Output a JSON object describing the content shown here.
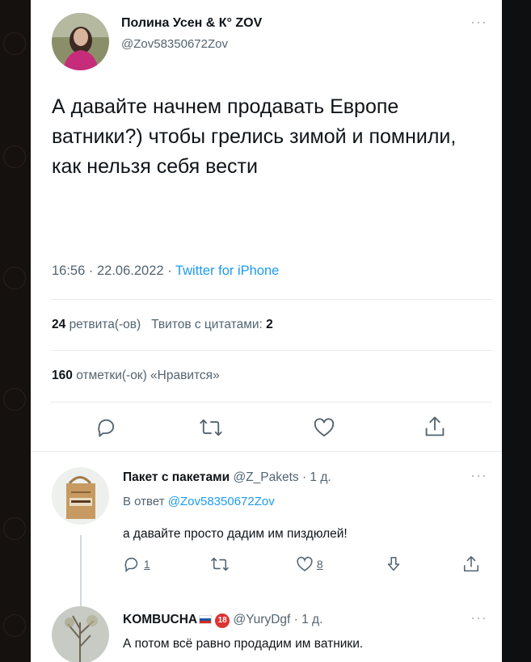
{
  "tweet": {
    "author_name": "Полина Усен & К° ZOV",
    "author_handle": "@Zov58350672Zov",
    "text": "А давайте начнем продавать Европе ватники?) чтобы грелись зимой и помнили, как нельзя себя вести",
    "time": "16:56",
    "date": "22.06.2022",
    "source": "Twitter for iPhone",
    "retweets_count": "24",
    "retweets_label": "ретвита(-ов)",
    "quotes_label": "Твитов с цитатами:",
    "quotes_count": "2",
    "likes_count": "160",
    "likes_label": "отметки(-ок) «Нравится»"
  },
  "replies": [
    {
      "name": "Пакет с пакетами",
      "handle_time": "@Z_Pakets · 1 д.",
      "reply_to_label": "В ответ",
      "reply_to_handle": "@Zov58350672Zov",
      "text": "а давайте просто дадим им пиздюлей!",
      "reply_count": "1",
      "like_count": "8"
    },
    {
      "name": "KOMBUCHA",
      "handle_time": "@YuryDgf · 1 д.",
      "text": "А потом всё равно продадим им ватники.",
      "badge": "18"
    }
  ],
  "icons": {
    "reply": "reply-icon",
    "retweet": "retweet-icon",
    "like": "heart-icon",
    "share": "share-icon",
    "more": "more-icon",
    "tip": "tip-icon"
  },
  "colors": {
    "link": "#1d9bf0",
    "secondary_text": "#536471",
    "primary_text": "#0f1419"
  }
}
